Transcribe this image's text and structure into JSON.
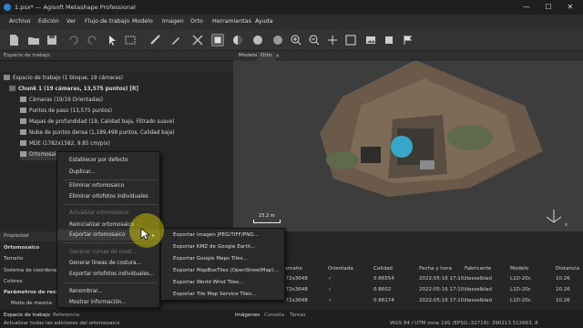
{
  "window": {
    "title": "1.psx* — Agisoft Metashape Professional",
    "controls": [
      "—",
      "☐",
      "✕"
    ]
  },
  "menu": [
    "Archivo",
    "Edición",
    "Ver",
    "Flujo de trabajo",
    "Modelo",
    "Imagen",
    "Orto",
    "Herramientas",
    "Ayuda"
  ],
  "workspace": {
    "header": "Espacio de trabajo",
    "root": "Espacio de trabajo (1 bloque, 19 cámaras)",
    "chunk": "Chunk 1 (19 cámaras, 13,575 puntos) [R]",
    "items": [
      "Cámaras (19/19 Orientadas)",
      "Puntos de paso (13,575 puntos)",
      "Mapas de profundidad (19, Calidad baja, Filtrado suave)",
      "Nube de puntos densa (1,189,498 puntos, Calidad baja)",
      "MDE (1782x1582, 9.85 cm/pix)",
      "Ortomosaico"
    ]
  },
  "viewport": {
    "tabs": [
      "Modelo",
      "Orto"
    ],
    "scale_label": "23.2 m",
    "axis_label": "x"
  },
  "context_menu": {
    "items": [
      {
        "label": "Establecer por defecto",
        "disabled": false
      },
      {
        "label": "Duplicar...",
        "disabled": false
      },
      {
        "label": "Eliminar ortomosaico",
        "disabled": false
      },
      {
        "label": "Eliminar ortofotos individuales",
        "disabled": false
      },
      {
        "label": "Actualizar ortomosaico",
        "disabled": true
      },
      {
        "label": "Reinicializar ortomosaico",
        "disabled": false
      },
      {
        "label": "Exportar ortomosaico",
        "disabled": false
      },
      {
        "label": "Generar curvas de nivel...",
        "disabled": true
      },
      {
        "label": "Generar líneas de costura...",
        "disabled": false
      },
      {
        "label": "Exportar ortofotos individuales...",
        "disabled": false
      },
      {
        "label": "Renombrar...",
        "disabled": false
      },
      {
        "label": "Mostrar información...",
        "disabled": false
      }
    ]
  },
  "submenu": {
    "items": [
      "Exportar imagen JPEG/TIFF/PNG...",
      "Exportar KMZ de Google Earth...",
      "Exportar Google Maps Tiles...",
      "Exportar MapBoxTiles (OpenStreetMap)...",
      "Exportar World Wind Tiles...",
      "Exportar Tile Map Service Tiles..."
    ]
  },
  "properties": {
    "header": "Propiedad",
    "rows": [
      "Ortomosaico",
      "Tamaño",
      "Sistema de coordenada",
      "Colores",
      "Parámetros de recons",
      "Modo de mezcla"
    ]
  },
  "photos": {
    "columns": [
      "Tamaño",
      "Orientada",
      "Calidad",
      "Fecha y hora",
      "Fabricante",
      "Modelo",
      "Distancia"
    ],
    "rows": [
      {
        "size": "472x3648",
        "quality": "0.86554",
        "date": "2022:05:16 17:10...",
        "maker": "Hasselblad",
        "model": "L1D-20c",
        "dist": "10.26"
      },
      {
        "size": "472x3648",
        "quality": "0.8602",
        "date": "2022:05:16 17:10...",
        "maker": "Hasselblad",
        "model": "L1D-20c",
        "dist": "10.26"
      },
      {
        "size": "472x3648",
        "quality": "0.86174",
        "date": "2022:05:16 17:10...",
        "maker": "Hasselblad",
        "model": "L1D-20c",
        "dist": "10.26"
      }
    ]
  },
  "status": {
    "tabs_left": [
      "Espacio de trabajo",
      "Referencia"
    ],
    "tabs_right": [
      "Imágenes",
      "Consola",
      "Tareas"
    ],
    "left_text": "Actualizar todas las ediciones del ortomosaico",
    "right_text": "WGS 84 / UTM zone 19S (EPSG::32719): 390213.512663, 8"
  }
}
